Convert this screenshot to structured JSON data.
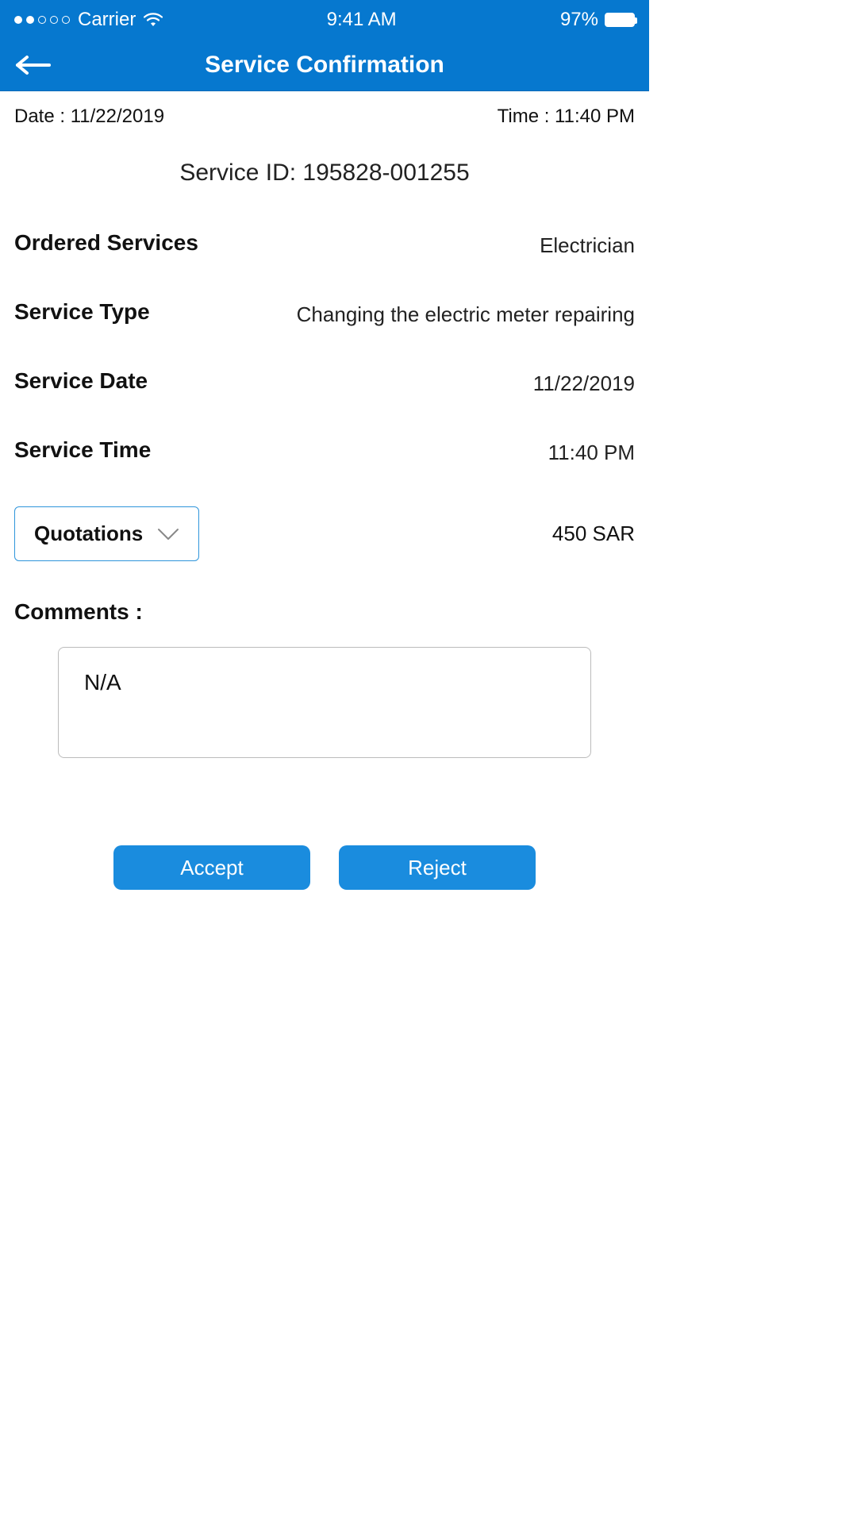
{
  "status": {
    "carrier": "Carrier",
    "time": "9:41 AM",
    "battery_pct": "97%"
  },
  "nav": {
    "title": "Service Confirmation"
  },
  "meta": {
    "date_label": "Date :",
    "date_value": "11/22/2019",
    "time_label": "Time :",
    "time_value": "11:40 PM"
  },
  "service_id_label": "Service ID:",
  "service_id_value": "195828-001255",
  "rows": {
    "ordered_services": {
      "label": "Ordered Services",
      "value": "Electrician"
    },
    "service_type": {
      "label": "Service Type",
      "value": "Changing the electric meter repairing"
    },
    "service_date": {
      "label": "Service Date",
      "value": "11/22/2019"
    },
    "service_time": {
      "label": "Service Time",
      "value": "11:40 PM"
    }
  },
  "quotations": {
    "label": "Quotations",
    "value": "450 SAR"
  },
  "comments": {
    "label": "Comments :",
    "value": "N/A"
  },
  "buttons": {
    "accept": "Accept",
    "reject": "Reject"
  }
}
